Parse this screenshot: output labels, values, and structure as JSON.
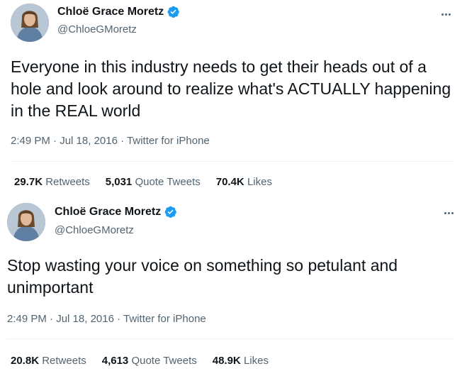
{
  "tweets": [
    {
      "author": {
        "display_name": "Chloë Grace Moretz",
        "handle": "@ChloeGMoretz",
        "verified": true
      },
      "text": "Everyone in this industry needs to get their heads out of a hole and look around to realize what's ACTUALLY happening in the REAL world",
      "time": "2:49 PM",
      "date": "Jul 18, 2016",
      "source": "Twitter for iPhone",
      "separator": "·",
      "stats": [
        {
          "count": "29.7K",
          "label": "Retweets"
        },
        {
          "count": "5,031",
          "label": "Quote Tweets"
        },
        {
          "count": "70.4K",
          "label": "Likes"
        }
      ]
    },
    {
      "author": {
        "display_name": "Chloë Grace Moretz",
        "handle": "@ChloeGMoretz",
        "verified": true
      },
      "text": "Stop wasting your voice on something so petulant and unimportant",
      "time": "2:49 PM",
      "date": "Jul 18, 2016",
      "source": "Twitter for iPhone",
      "separator": "·",
      "stats": [
        {
          "count": "20.8K",
          "label": "Retweets"
        },
        {
          "count": "4,613",
          "label": "Quote Tweets"
        },
        {
          "count": "48.9K",
          "label": "Likes"
        }
      ]
    }
  ],
  "icons": {
    "verified": "verified-badge-icon",
    "more": "more-options-icon"
  },
  "colors": {
    "verified_blue": "#1d9bf0",
    "secondary_text": "#536471",
    "primary_text": "#0f1419"
  }
}
